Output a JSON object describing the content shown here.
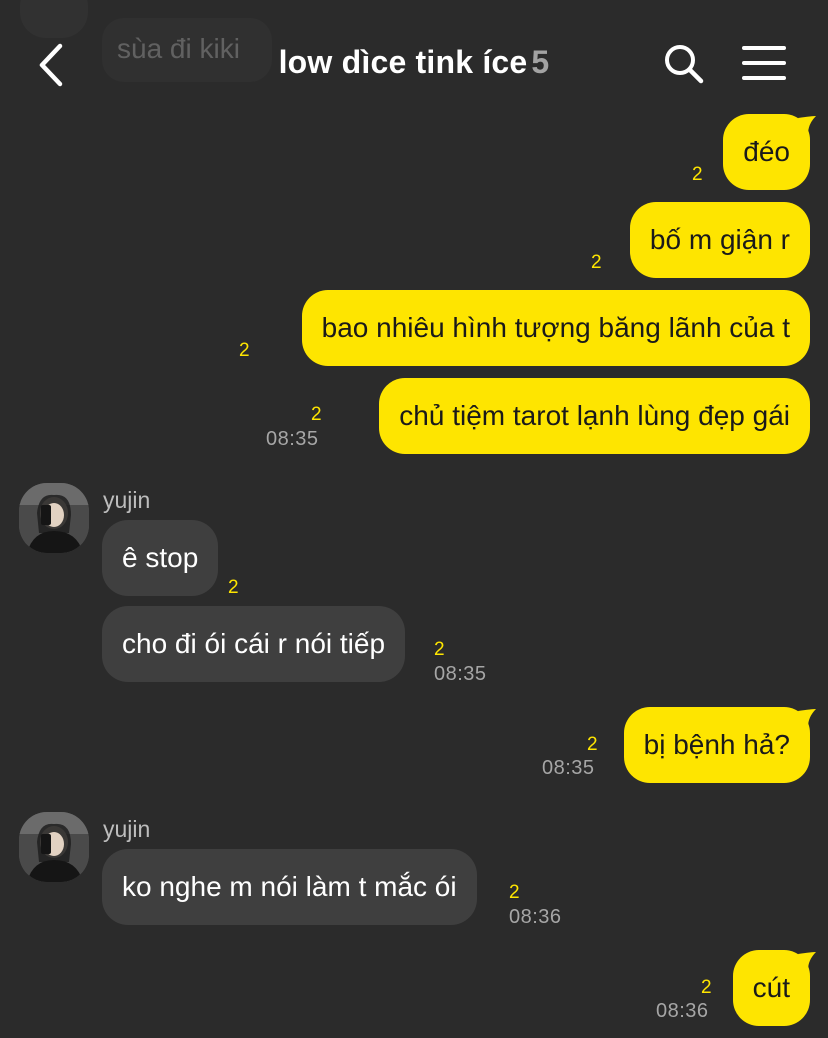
{
  "header": {
    "title": "low dìce tink íce",
    "member_count": "5",
    "back_icon": "chevron-left-icon",
    "search_icon": "search-icon",
    "menu_icon": "hamburger-menu-icon"
  },
  "ghost": {
    "text": "sùa đi kiki"
  },
  "colors": {
    "my_bubble": "#fee500",
    "their_bubble": "#3f3f3f",
    "background": "#2b2b2b",
    "unread": "#fee500"
  },
  "messages": [
    {
      "sender": "me",
      "text": "đéo",
      "unread": "2",
      "time": ""
    },
    {
      "sender": "me",
      "text": "bố m giận r",
      "unread": "2",
      "time": ""
    },
    {
      "sender": "me",
      "text": "bao nhiêu hình tượng băng lãnh của t",
      "unread": "2",
      "time": ""
    },
    {
      "sender": "me",
      "text": "chủ tiệm tarot lạnh lùng đẹp gái",
      "unread": "2",
      "time": "08:35"
    },
    {
      "sender": "yujin",
      "name": "yujin",
      "text": "ê stop",
      "unread": "2",
      "time": ""
    },
    {
      "sender": "yujin",
      "text": "cho đi ói cái r nói tiếp",
      "unread": "2",
      "time": "08:35"
    },
    {
      "sender": "me",
      "text": "bị bệnh hả?",
      "unread": "2",
      "time": "08:35"
    },
    {
      "sender": "yujin",
      "name": "yujin",
      "text": "ko nghe m nói làm t mắc ói",
      "unread": "2",
      "time": "08:36"
    },
    {
      "sender": "me",
      "text": "cút",
      "unread": "2",
      "time": "08:36"
    }
  ]
}
